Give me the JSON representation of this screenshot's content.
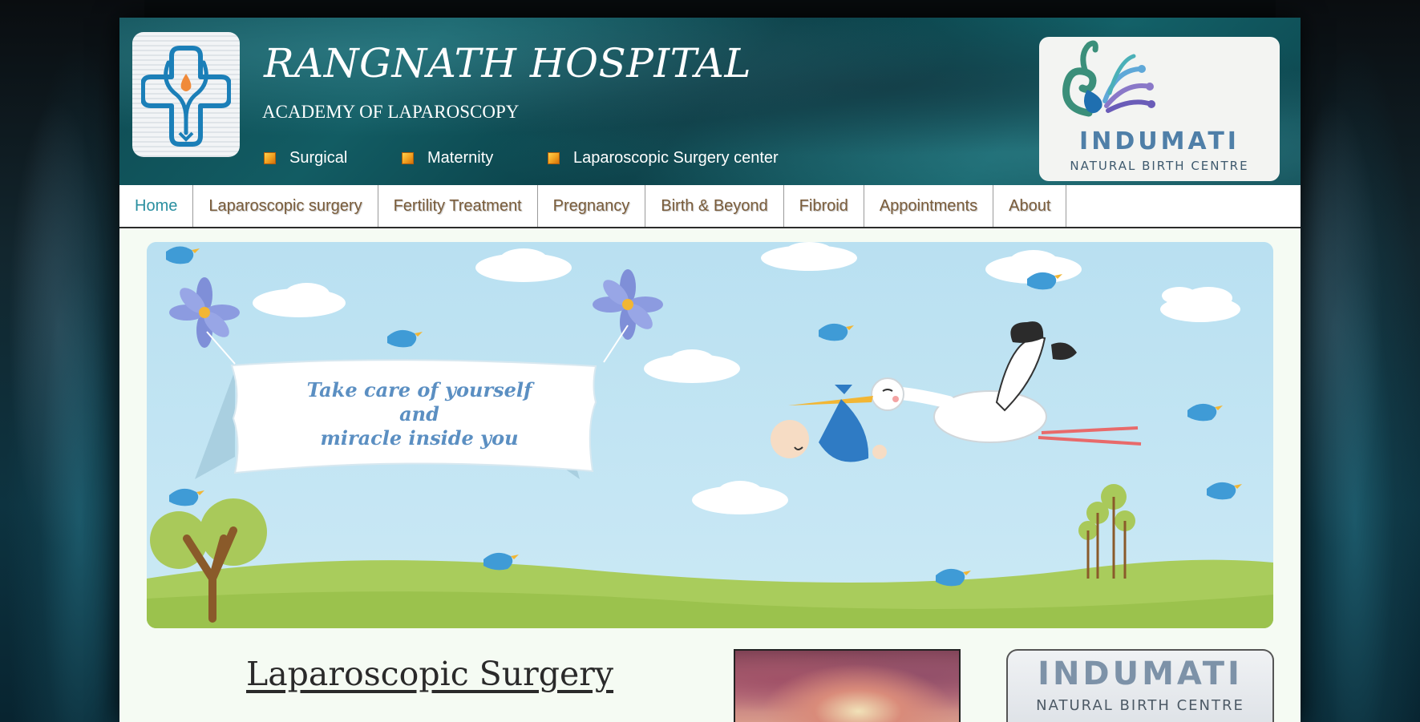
{
  "hospital": {
    "name": "RANGNATH HOSPITAL",
    "subtitle": "ACADEMY OF LAPAROSCOPY"
  },
  "taglines": [
    "Surgical",
    "Maternity",
    "Laparoscopic Surgery center"
  ],
  "indumati": {
    "name": "INDUMATI",
    "subtitle": "NATURAL BIRTH CENTRE"
  },
  "nav": {
    "items": [
      {
        "label": "Home",
        "active": true
      },
      {
        "label": "Laparoscopic surgery",
        "active": false
      },
      {
        "label": "Fertility Treatment",
        "active": false
      },
      {
        "label": "Pregnancy",
        "active": false
      },
      {
        "label": "Birth & Beyond",
        "active": false
      },
      {
        "label": "Fibroid",
        "active": false
      },
      {
        "label": "Appointments",
        "active": false
      },
      {
        "label": "About",
        "active": false
      }
    ]
  },
  "banner": {
    "line1": "Take care of yourself",
    "line2": "and",
    "line3": "miracle inside you"
  },
  "section": {
    "title": "Laparoscopic Surgery"
  },
  "colors": {
    "header_teal": "#0e4a52",
    "nav_text": "#7a5c3a",
    "nav_active": "#2a8fa0",
    "banner_text": "#5b8fc2",
    "bullet": "#f0a020"
  },
  "icons": [
    "hospital-cross-logo-icon",
    "swan-peacock-logo-icon",
    "stork-icon",
    "bird-icon",
    "flower-icon",
    "cloud-icon",
    "tree-icon"
  ]
}
